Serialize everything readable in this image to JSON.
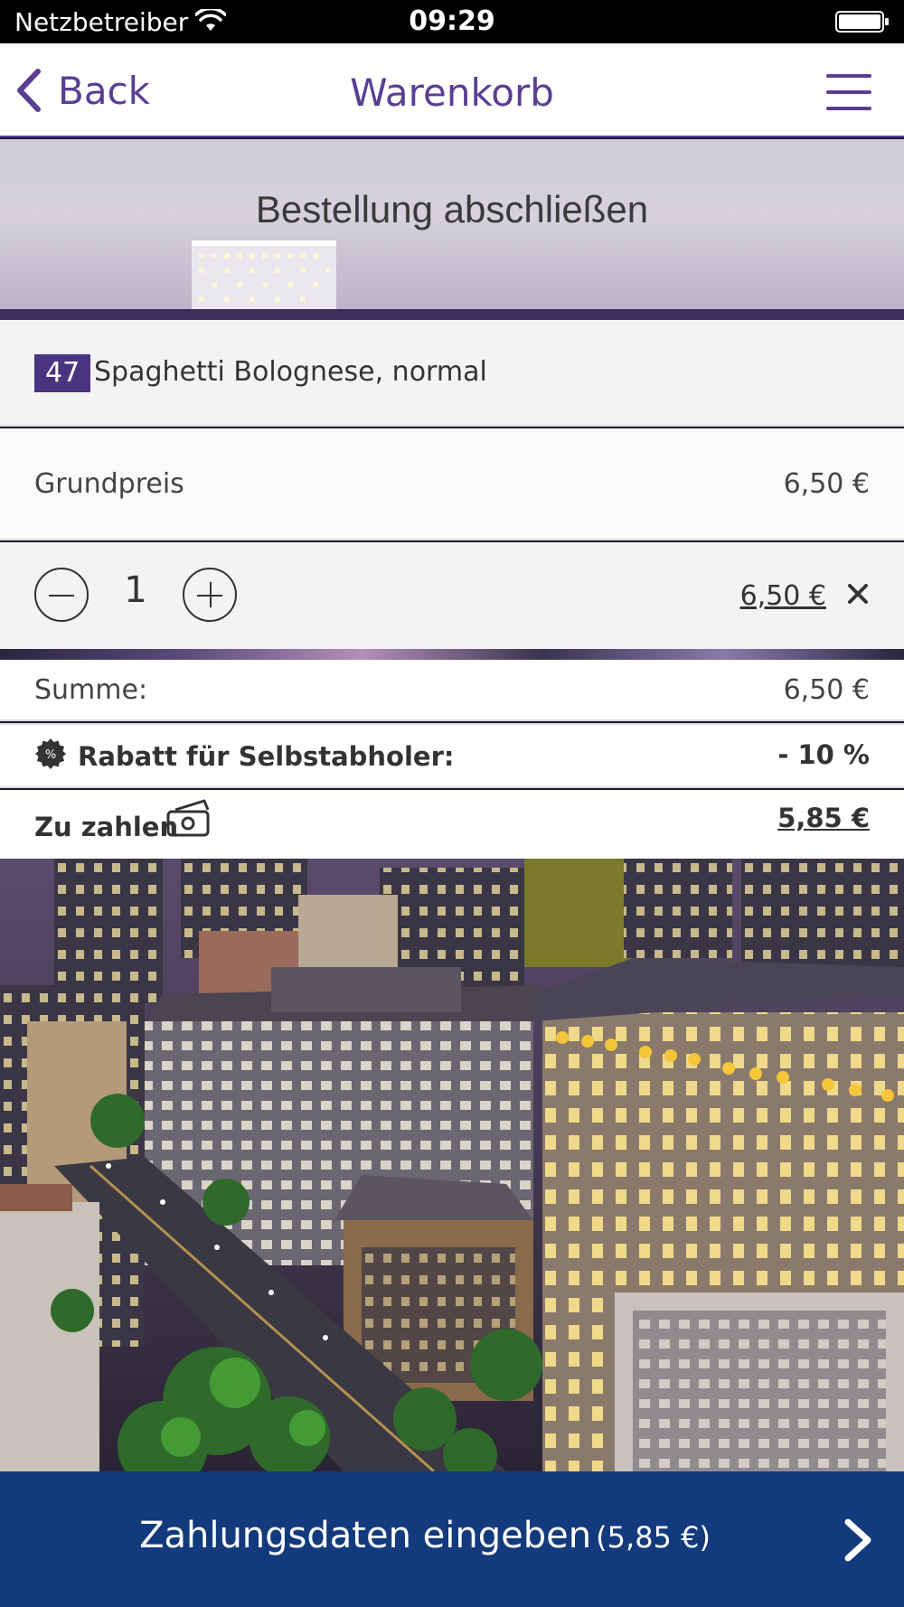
{
  "status_bar": {
    "carrier": "Netzbetreiber",
    "time": "09:29"
  },
  "nav": {
    "back_label": "Back",
    "title": "Warenkorb"
  },
  "header": {
    "title": "Bestellung abschließen"
  },
  "item": {
    "number": "47",
    "name": "Spaghetti Bolognese, normal"
  },
  "base_price": {
    "label": "Grundpreis",
    "value": "6,50 €"
  },
  "quantity": {
    "value": "1",
    "line_total": "6,50 €"
  },
  "summary": {
    "sum_label": "Summe:",
    "sum_value": "6,50 €",
    "discount_label": "Rabatt für Selbstabholer:",
    "discount_value": "- 10 %",
    "pay_label": "Zu zahlen",
    "pay_value": "5,85 €"
  },
  "checkout": {
    "label": "Zahlungsdaten eingeben",
    "amount": "(5,85 €)"
  },
  "colors": {
    "accent": "#5a3e93",
    "item_badge": "#4a3482",
    "checkout_bg": "#123a7c"
  },
  "icons": [
    "wifi-icon",
    "battery-icon",
    "back-chevron-icon",
    "menu-icon",
    "minus-icon",
    "plus-icon",
    "close-icon",
    "discount-icon",
    "cash-icon",
    "chevron-right-icon"
  ]
}
